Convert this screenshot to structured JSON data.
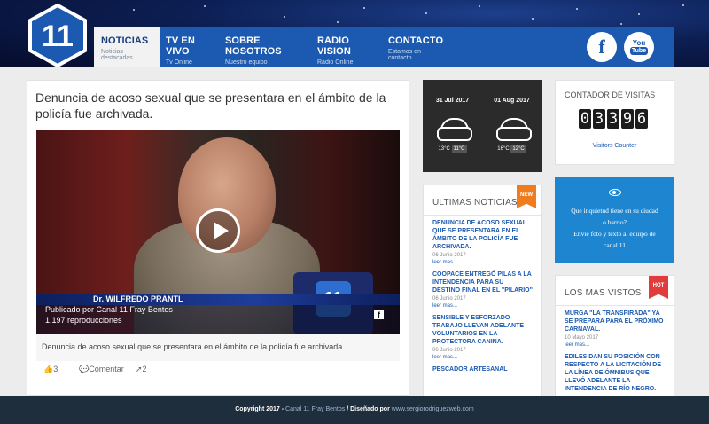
{
  "header": {
    "logo_text": "11",
    "nav": [
      {
        "title": "NOTICIAS",
        "subtitle": "Noticias destacadas"
      },
      {
        "title": "TV EN VIVO",
        "subtitle": "Tv Online"
      },
      {
        "title": "SOBRE NOSOTROS",
        "subtitle": "Nuestro equipo"
      },
      {
        "title": "RADIO VISION",
        "subtitle": "Radio Online"
      },
      {
        "title": "CONTACTO",
        "subtitle": "Estamos en contacto"
      }
    ],
    "facebook_glyph": "f",
    "youtube_top": "You",
    "youtube_bottom": "Tube"
  },
  "article": {
    "title": "Denuncia de acoso sexual que se presentara en el ámbito de la policía fue archivada.",
    "video": {
      "lower_third_name": "Dr. WILFREDO PRANTL",
      "published_by": "Publicado por Canal 11 Fray Bentos",
      "views": "1.197 reproducciones",
      "fb_glyph": "f",
      "mic_logo": "11"
    },
    "caption": "Denuncia de acoso sexual que se presentara en el ámbito de la policía fue archivada.",
    "likes": "3",
    "comment_label": "Comentar",
    "shares": "2"
  },
  "weather": [
    {
      "date": "31 Jul 2017",
      "min": "13°C",
      "max": "11°C"
    },
    {
      "date": "01 Aug 2017",
      "min": "16°C",
      "max": "12°C"
    }
  ],
  "ultimas": {
    "heading": "ULTIMAS NOTICIAS",
    "badge": "NEW",
    "items": [
      {
        "title": "DENUNCIA DE ACOSO SEXUAL QUE SE PRESENTARA EN EL ÁMBITO DE LA POLICÍA FUE ARCHIVADA.",
        "date": "06 Junio 2017",
        "more": "leer mas..."
      },
      {
        "title": "COOPACE ENTREGÓ PILAS A LA INTENDENCIA PARA SU DESTINO FINAL EN EL \"PILARIO\"",
        "date": "06 Junio 2017",
        "more": "leer mas..."
      },
      {
        "title": "SENSIBLE Y ESFORZADO TRABAJO LLEVAN ADELANTE VOLUNTARIOS EN LA PROTECTORA CANINA.",
        "date": "06 Junio 2017",
        "more": "leer mas..."
      },
      {
        "title": "PESCADOR ARTESANAL",
        "date": "",
        "more": ""
      }
    ]
  },
  "contador": {
    "heading": "CONTADOR DE VISITAS",
    "digits": [
      "0",
      "3",
      "3",
      "9",
      "6"
    ],
    "label": "Visitors Counter"
  },
  "inquietud": {
    "line1": "Que inquietud tiene en su ciudad",
    "line2": "o barrio?",
    "line3": "Envíe foto y texto al equipo de",
    "line4": "canal 11"
  },
  "mas_vistos": {
    "heading": "LOS MAS VISTOS",
    "badge": "HOT",
    "items": [
      {
        "title": "MURGA \"LA TRANSPIRADA\" YA SE PREPARA PARA EL PRÓXIMO CARNAVAL.",
        "date": "10 Mayo 2017",
        "more": "leer mas..."
      },
      {
        "title": "EDILES DAN SU POSICIÓN CON RESPECTO A LA LICITACIÓN DE LA LÍNEA DE ÓMNIBUS QUE LLEVÓ ADELANTE LA INTENDENCIA DE RÍO NEGRO.",
        "date": "",
        "more": ""
      }
    ]
  },
  "footer": {
    "copyright": "Copyright 2017 -",
    "site": "Canal 11 Fray Bentos",
    "designed": "/ Diseñado por",
    "designer": "www.sergiorodriguezweb.com"
  },
  "colors": {
    "nav_blue": "#1b5ab0",
    "link_blue": "#1b5ab0",
    "new_badge": "#f07c1e",
    "hot_badge": "#e23b3b",
    "inquietud_bg": "#1e86d0",
    "footer_bg": "#1f2e3c"
  }
}
